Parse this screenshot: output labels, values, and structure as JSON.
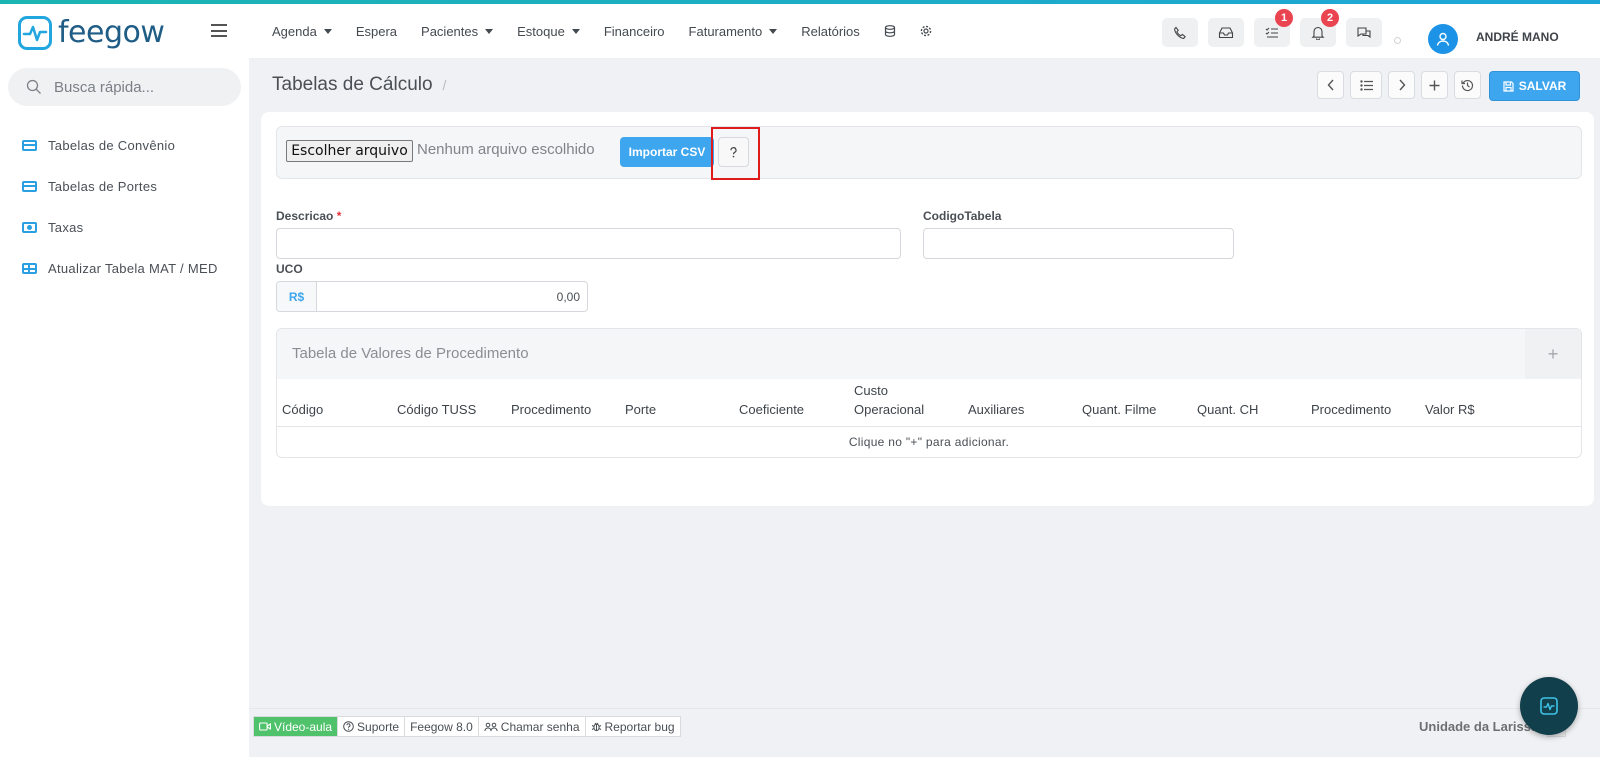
{
  "app": {
    "logo_text": "feegow",
    "brand_color": "#22a6e0",
    "accent_color": "#3ea6ee"
  },
  "nav": {
    "items": [
      {
        "label": "Agenda",
        "dropdown": true
      },
      {
        "label": "Espera",
        "dropdown": false
      },
      {
        "label": "Pacientes",
        "dropdown": true
      },
      {
        "label": "Estoque",
        "dropdown": true
      },
      {
        "label": "Financeiro",
        "dropdown": false
      },
      {
        "label": "Faturamento",
        "dropdown": true
      },
      {
        "label": "Relatórios",
        "dropdown": false
      }
    ],
    "icons": [
      "database-icon",
      "gear-icon"
    ]
  },
  "topbar": {
    "buttons": [
      "phone-icon",
      "inbox-icon",
      "tasks-icon",
      "bell-icon",
      "chat-icon"
    ],
    "tasks_badge": "1",
    "bell_badge": "2",
    "user_name": "ANDRÉ MANO"
  },
  "sidebar": {
    "search_placeholder": "Busca rápida...",
    "items": [
      {
        "label": "Tabelas de Convênio",
        "icon": "card-icon"
      },
      {
        "label": "Tabelas de Portes",
        "icon": "card-icon"
      },
      {
        "label": "Taxas",
        "icon": "money-icon"
      },
      {
        "label": "Atualizar Tabela MAT / MED",
        "icon": "table-icon"
      }
    ]
  },
  "page": {
    "title": "Tabelas de Cálculo",
    "breadcrumb_sep": "/",
    "save_label": "SALVAR"
  },
  "import": {
    "file_button": "Escolher arquivo",
    "file_status": "Nenhum arquivo escolhido",
    "import_button": "Importar CSV",
    "help_icon": "question-icon"
  },
  "form": {
    "descricao_label": "Descricao",
    "descricao_required": "*",
    "descricao_value": "",
    "codigo_label": "CodigoTabela",
    "codigo_value": "",
    "uco_label": "UCO",
    "uco_prefix": "R$",
    "uco_value": "0,00"
  },
  "table": {
    "title": "Tabela de Valores de Procedimento",
    "add_label": "+",
    "columns": [
      "Código",
      "Código TUSS",
      "Procedimento",
      "Porte",
      "Coeficiente",
      "Custo Operacional",
      "Auxiliares",
      "Quant. Filme",
      "Quant. CH",
      "Procedimento",
      "Valor R$"
    ],
    "empty_message": "Clique no  \"+\" para adicionar."
  },
  "footer": {
    "items": [
      "Vídeo-aula",
      "Suporte",
      "Feegow 8.0",
      "Chamar senha",
      "Reportar bug"
    ],
    "unit": "Unidade da Larissa"
  }
}
